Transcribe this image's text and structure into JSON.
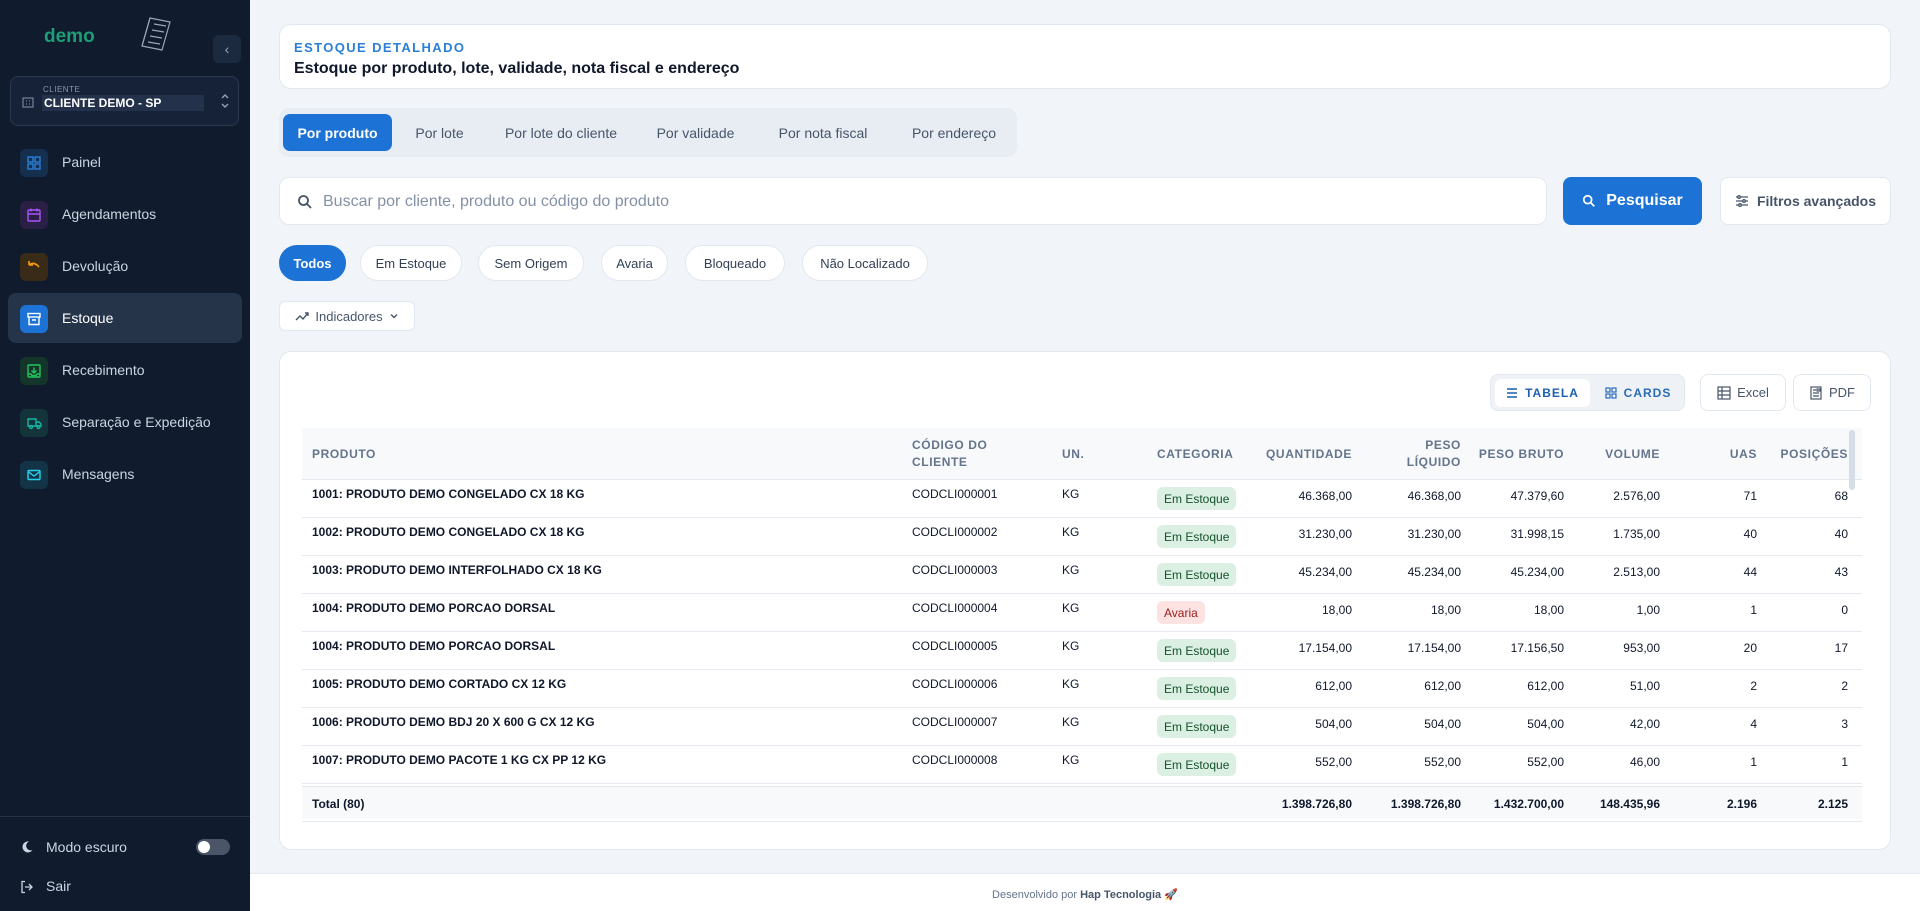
{
  "sidebar": {
    "brand": "demo",
    "collapse_glyph": "‹",
    "client_label": "CLIENTE",
    "client_name": "CLIENTE DEMO - SP",
    "items": [
      {
        "label": "Painel",
        "icon": "grid-icon",
        "color": "#2b7fd8",
        "bg": "#15304f"
      },
      {
        "label": "Agendamentos",
        "icon": "calendar-icon",
        "color": "#a855f7",
        "bg": "#2a1f45"
      },
      {
        "label": "Devolução",
        "icon": "undo-icon",
        "color": "#f59e0b",
        "bg": "#3a2a18"
      },
      {
        "label": "Estoque",
        "icon": "archive-icon",
        "color": "#ffffff",
        "bg": "#1d72d6"
      },
      {
        "label": "Recebimento",
        "icon": "inbox-download-icon",
        "color": "#22c55e",
        "bg": "#14352a"
      },
      {
        "label": "Separação e Expedição",
        "icon": "truck-icon",
        "color": "#14b8a6",
        "bg": "#13343a"
      },
      {
        "label": "Mensagens",
        "icon": "mail-icon",
        "color": "#22d3ee",
        "bg": "#133447"
      }
    ],
    "dark_mode_label": "Modo escuro",
    "exit_label": "Sair"
  },
  "header": {
    "eyebrow": "ESTOQUE DETALHADO",
    "title": "Estoque por produto, lote, validade, nota fiscal e endereço"
  },
  "tabs": [
    "Por produto",
    "Por lote",
    "Por lote do cliente",
    "Por validade",
    "Por nota fiscal",
    "Por endereço"
  ],
  "search": {
    "placeholder": "Buscar por cliente, produto ou código do produto",
    "button_label": "Pesquisar",
    "filters_label": "Filtros avançados"
  },
  "chips": [
    "Todos",
    "Em Estoque",
    "Sem Origem",
    "Avaria",
    "Bloqueado",
    "Não Localizado"
  ],
  "indicators_label": "Indicadores",
  "view": {
    "table_label": "TABELA",
    "cards_label": "CARDS",
    "excel_label": "Excel",
    "pdf_label": "PDF"
  },
  "table": {
    "columns": [
      "PRODUTO",
      "CÓDIGO DO CLIENTE",
      "UN.",
      "CATEGORIA",
      "QUANTIDADE",
      "PESO LÍQUIDO",
      "PESO BRUTO",
      "VOLUME",
      "UAS",
      "POSIÇÕES"
    ],
    "rows": [
      {
        "produto": "1001: PRODUTO DEMO CONGELADO CX 18 KG",
        "codigo": "CODCLI000001",
        "un": "KG",
        "categoria": "Em Estoque",
        "quantidade": "46.368,00",
        "peso_liquido": "46.368,00",
        "peso_bruto": "47.379,60",
        "volume": "2.576,00",
        "uas": "71",
        "posicoes": "68"
      },
      {
        "produto": "1002: PRODUTO DEMO CONGELADO CX 18 KG",
        "codigo": "CODCLI000002",
        "un": "KG",
        "categoria": "Em Estoque",
        "quantidade": "31.230,00",
        "peso_liquido": "31.230,00",
        "peso_bruto": "31.998,15",
        "volume": "1.735,00",
        "uas": "40",
        "posicoes": "40"
      },
      {
        "produto": "1003: PRODUTO DEMO INTERFOLHADO CX 18 KG",
        "codigo": "CODCLI000003",
        "un": "KG",
        "categoria": "Em Estoque",
        "quantidade": "45.234,00",
        "peso_liquido": "45.234,00",
        "peso_bruto": "45.234,00",
        "volume": "2.513,00",
        "uas": "44",
        "posicoes": "43"
      },
      {
        "produto": "1004: PRODUTO DEMO PORCAO DORSAL",
        "codigo": "CODCLI000004",
        "un": "KG",
        "categoria": "Avaria",
        "quantidade": "18,00",
        "peso_liquido": "18,00",
        "peso_bruto": "18,00",
        "volume": "1,00",
        "uas": "1",
        "posicoes": "0"
      },
      {
        "produto": "1004: PRODUTO DEMO PORCAO DORSAL",
        "codigo": "CODCLI000005",
        "un": "KG",
        "categoria": "Em Estoque",
        "quantidade": "17.154,00",
        "peso_liquido": "17.154,00",
        "peso_bruto": "17.156,50",
        "volume": "953,00",
        "uas": "20",
        "posicoes": "17"
      },
      {
        "produto": "1005: PRODUTO DEMO CORTADO CX 12 KG",
        "codigo": "CODCLI000006",
        "un": "KG",
        "categoria": "Em Estoque",
        "quantidade": "612,00",
        "peso_liquido": "612,00",
        "peso_bruto": "612,00",
        "volume": "51,00",
        "uas": "2",
        "posicoes": "2"
      },
      {
        "produto": "1006: PRODUTO DEMO BDJ 20 X 600 G CX 12 KG",
        "codigo": "CODCLI000007",
        "un": "KG",
        "categoria": "Em Estoque",
        "quantidade": "504,00",
        "peso_liquido": "504,00",
        "peso_bruto": "504,00",
        "volume": "42,00",
        "uas": "4",
        "posicoes": "3"
      },
      {
        "produto": "1007: PRODUTO DEMO PACOTE 1 KG CX PP 12 KG",
        "codigo": "CODCLI000008",
        "un": "KG",
        "categoria": "Em Estoque",
        "quantidade": "552,00",
        "peso_liquido": "552,00",
        "peso_bruto": "552,00",
        "volume": "46,00",
        "uas": "1",
        "posicoes": "1"
      }
    ],
    "total": {
      "label": "Total (80)",
      "quantidade": "1.398.726,80",
      "peso_liquido": "1.398.726,80",
      "peso_bruto": "1.432.700,00",
      "volume": "148.435,96",
      "uas": "2.196",
      "posicoes": "2.125"
    }
  },
  "footer": {
    "prefix": "Desenvolvido por",
    "brand": "Hap Tecnologia",
    "emoji": "🚀"
  },
  "colors": {
    "accent": "#1d72d6",
    "sidebar": "#101b2e",
    "ok_badge": "#dcefe3",
    "bad_badge": "#fde2e2"
  }
}
